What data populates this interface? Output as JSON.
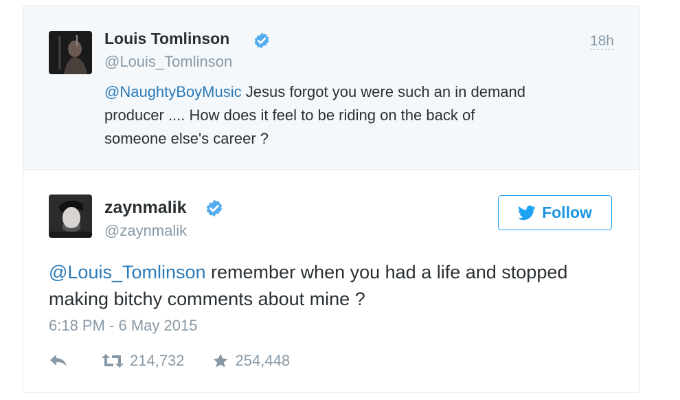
{
  "reply_tweet": {
    "author_name": "Louis Tomlinson",
    "author_handle": "@Louis_Tomlinson",
    "time_ago": "18h",
    "mention": "@NaughtyBoyMusic",
    "line1_rest": " Jesus forgot you were such an in demand",
    "line2": "producer .... How does it feel to be riding on the back of",
    "line3": "someone else's career ?"
  },
  "main_tweet": {
    "author_name": "zaynmalik",
    "author_handle": "@zaynmalik",
    "follow_label": "Follow",
    "mention": "@Louis_Tomlinson",
    "line1_rest": " remember when you had a life and stopped",
    "line2": "making bitchy comments about mine ?",
    "timestamp": "6:18 PM - 6 May 2015",
    "retweets": "214,732",
    "favorites": "254,448"
  },
  "colors": {
    "accent": "#1da1f2",
    "link": "#2b7bb9",
    "verified": "#55acee",
    "muted": "#8899a6",
    "text": "#292f33"
  },
  "icons": {
    "verified": "verified-badge-icon",
    "reply": "reply-arrow-icon",
    "retweet": "retweet-icon",
    "favorite": "star-icon",
    "follow_bird": "twitter-bird-icon"
  }
}
